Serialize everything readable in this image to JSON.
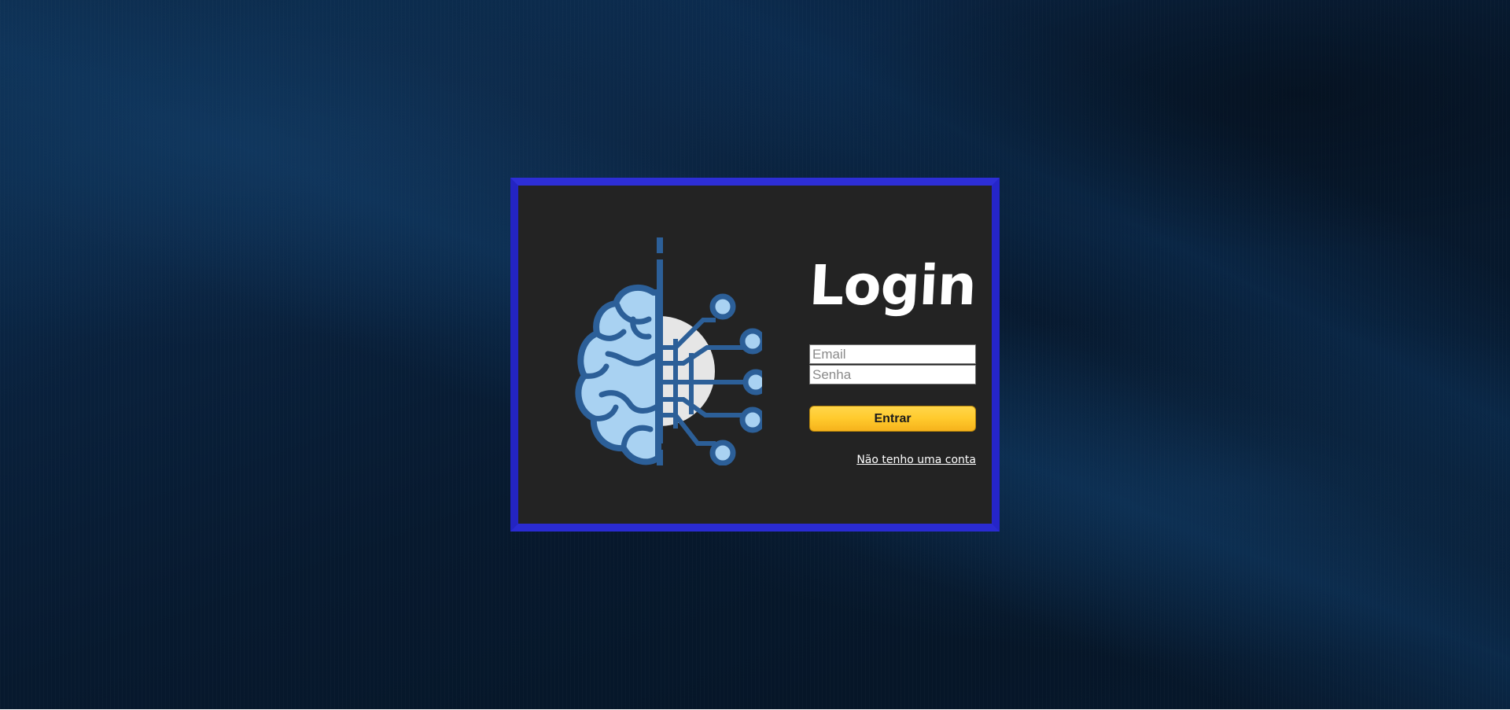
{
  "login": {
    "title": "Login",
    "email_placeholder": "Email",
    "password_placeholder": "Senha",
    "submit_label": "Entrar",
    "signup_link": "Não tenho uma conta"
  },
  "logo": {
    "icon": "brain-circuit-icon"
  },
  "colors": {
    "card_border": "#2d2ed6",
    "card_background": "#232323",
    "button": "#ffca2c",
    "brain_light": "#a9d2f2",
    "brain_dark": "#2c5f98",
    "chip": "#e6e6e6"
  }
}
